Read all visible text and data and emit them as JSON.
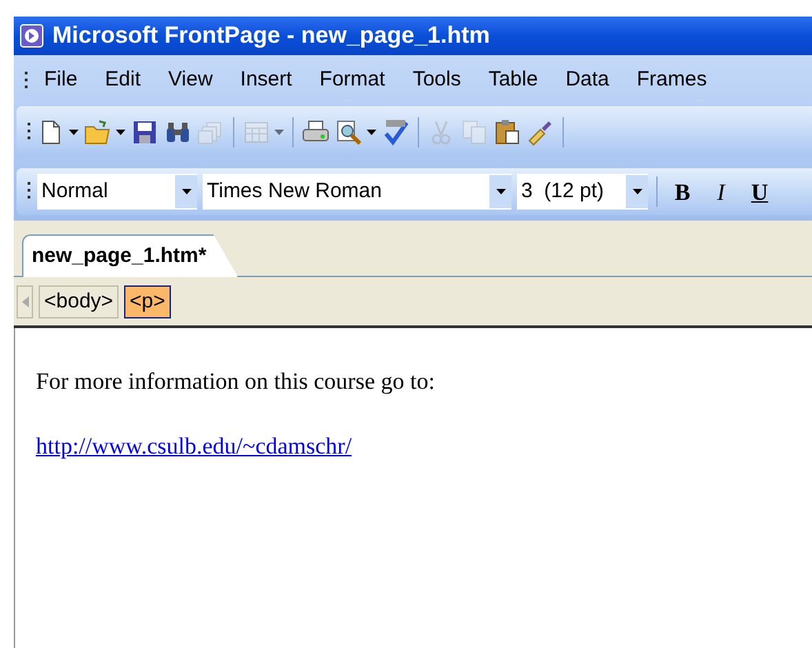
{
  "window": {
    "title": "Microsoft FrontPage - new_page_1.htm"
  },
  "menu": [
    "File",
    "Edit",
    "View",
    "Insert",
    "Format",
    "Tools",
    "Table",
    "Data",
    "Frames"
  ],
  "toolbar": [
    {
      "kind": "new",
      "disabled": false,
      "dropdown": true
    },
    {
      "kind": "open",
      "disabled": false,
      "dropdown": true
    },
    {
      "kind": "save",
      "disabled": false
    },
    {
      "kind": "find",
      "disabled": false
    },
    {
      "kind": "pages",
      "disabled": true
    },
    {
      "kind": "separator"
    },
    {
      "kind": "table",
      "disabled": true,
      "dropdown": true
    },
    {
      "kind": "separator"
    },
    {
      "kind": "print",
      "disabled": false
    },
    {
      "kind": "preview",
      "disabled": false,
      "dropdown": true
    },
    {
      "kind": "spelling",
      "disabled": false
    },
    {
      "kind": "separator"
    },
    {
      "kind": "cut",
      "disabled": true
    },
    {
      "kind": "copy",
      "disabled": true
    },
    {
      "kind": "paste",
      "disabled": false
    },
    {
      "kind": "painter",
      "disabled": false
    },
    {
      "kind": "separator"
    }
  ],
  "format_toolbar": {
    "style": "Normal",
    "font": "Times New Roman",
    "size": "3  (12 pt)",
    "buttons": [
      {
        "kind": "bold",
        "label": "B"
      },
      {
        "kind": "italic",
        "label": "I"
      },
      {
        "kind": "underline",
        "label": "U"
      }
    ]
  },
  "tabs": [
    {
      "label": "new_page_1.htm*",
      "selected": true
    }
  ],
  "tag_bar": [
    {
      "label": "<body>",
      "selected": false
    },
    {
      "label": "<p>",
      "selected": true
    }
  ],
  "document": {
    "paragraph": "For more information on this course go to:",
    "link": "http://www.csulb.edu/~cdamschr/"
  }
}
